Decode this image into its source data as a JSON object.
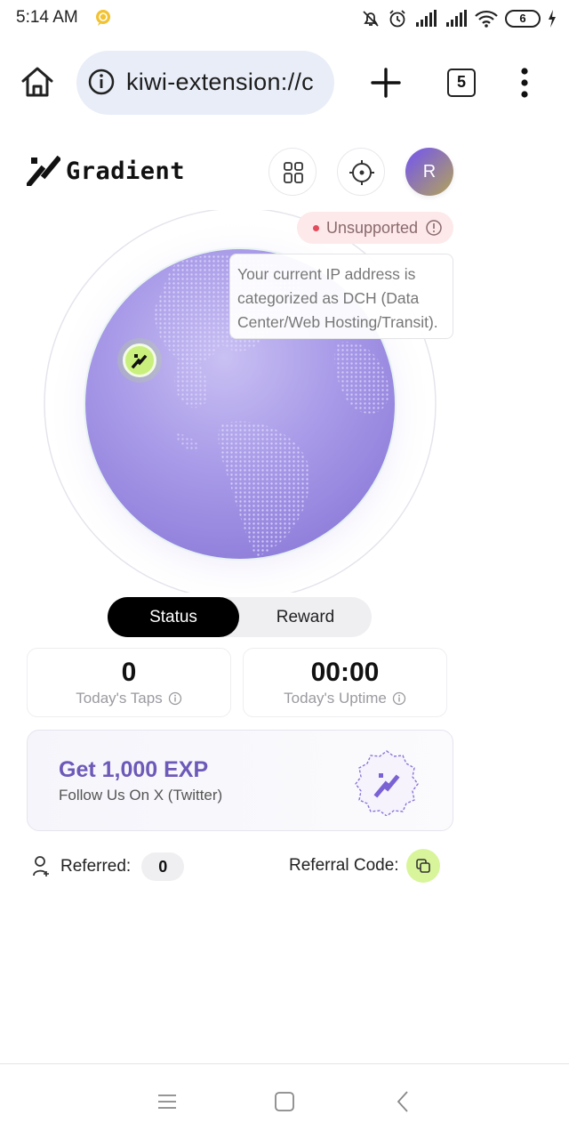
{
  "status_bar": {
    "time": "5:14 AM",
    "battery_level": "6"
  },
  "browser": {
    "url": "kiwi-extension://c",
    "tab_count": "5",
    "icons": [
      "home-icon",
      "info-icon",
      "plus-icon",
      "tabs-icon",
      "more-vert-icon"
    ]
  },
  "header": {
    "logo_text": "Gradient",
    "avatar_initial": "R",
    "icons": [
      "grid-icon",
      "crosshair-icon"
    ]
  },
  "network_status": {
    "label": "Unsupported",
    "tooltip": "Your current IP address is categorized as DCH (Data Center/Web Hosting/Transit).",
    "tooltip_lines": [
      "Your current IP address is",
      "categorized as DCH (Data",
      "Center/Web Hosting/Transit)."
    ],
    "status_color": "#e34c5a"
  },
  "tabs": {
    "active": "Status",
    "inactive": "Reward"
  },
  "stats": {
    "taps_value": "0",
    "taps_label": "Today's Taps",
    "uptime_value": "00:00",
    "uptime_label": "Today's Uptime"
  },
  "promo": {
    "title": "Get 1,000 EXP",
    "subtitle": "Follow Us On X (Twitter)"
  },
  "referral": {
    "referred_label": "Referred:",
    "referred_count": "0",
    "code_label": "Referral Code:"
  },
  "colors": {
    "accent_purple": "#6d59b8",
    "accent_green": "#c9f07c",
    "globe": "#a99be8"
  }
}
